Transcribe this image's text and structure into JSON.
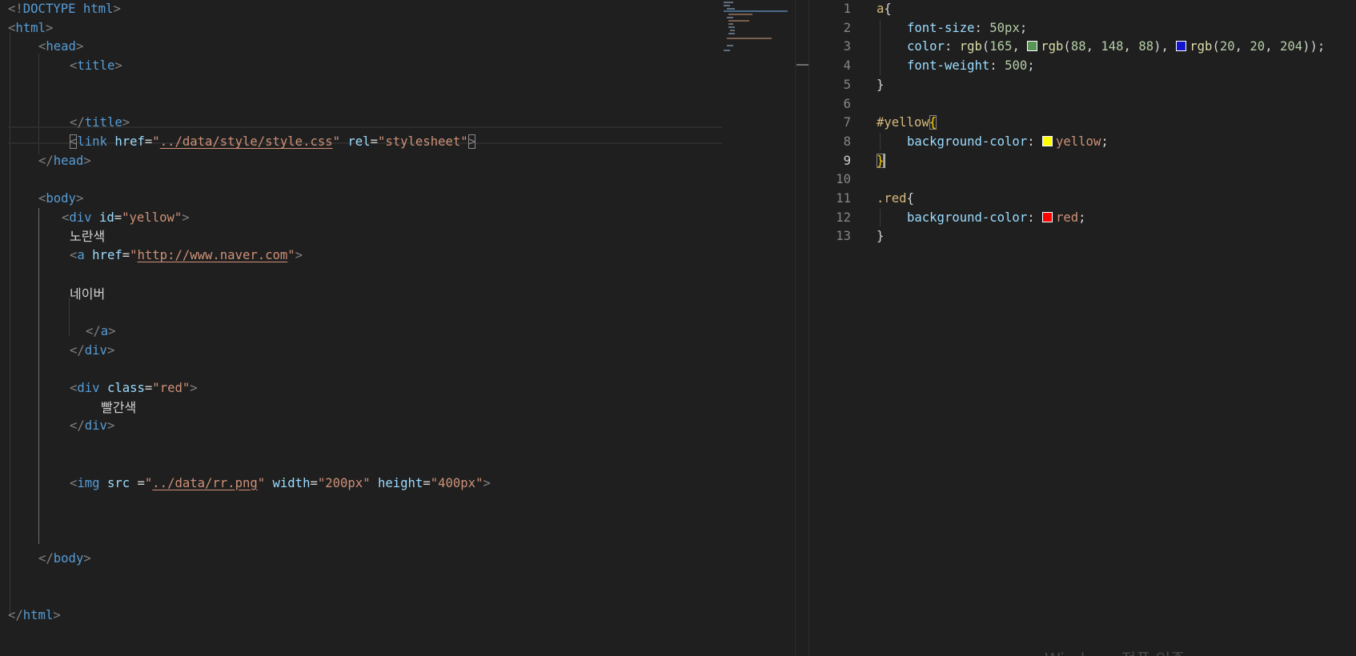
{
  "left_editor": {
    "lines": {
      "doctype": "DOCTYPE html",
      "html_open": "html",
      "head_open": "head",
      "title_open": "title",
      "title_close": "title",
      "link_tag": "link",
      "link_href_attr": "href",
      "link_href_val": "../data/style/style.css",
      "link_rel_attr": "rel",
      "link_rel_val": "stylesheet",
      "head_close": "head",
      "body_open": "body",
      "div_tag": "div",
      "div_id_attr": "id",
      "div_id_val": "yellow",
      "text_yellow": "노란색",
      "a_tag": "a",
      "a_href_attr": "href",
      "a_href_val": "http://www.naver.com",
      "text_naver": "네이버",
      "a_close": "a",
      "div_close": "div",
      "div2_tag": "div",
      "div2_class_attr": "class",
      "div2_class_val": "red",
      "text_red": "빨간색",
      "div2_close": "div",
      "img_tag": "img",
      "img_src_attr": "src",
      "img_src_val": "../data/rr.png",
      "img_width_attr": "width",
      "img_width_val": "200px",
      "img_height_attr": "height",
      "img_height_val": "400px",
      "body_close": "body",
      "html_close": "html"
    }
  },
  "right_editor": {
    "line_numbers": [
      "1",
      "2",
      "3",
      "4",
      "5",
      "6",
      "7",
      "8",
      "9",
      "10",
      "11",
      "12",
      "13"
    ],
    "active_line": "9",
    "css": {
      "sel_a": "a",
      "l2_prop": "font-size",
      "l2_val": "50px",
      "l3_prop": "color",
      "l3_fn1": "rgb",
      "l3_n1": "165",
      "l3_fn2": "rgb",
      "l3_n2a": "88",
      "l3_n2b": "148",
      "l3_n2c": "88",
      "l3_fn3": "rgb",
      "l3_n3a": "20",
      "l3_n3b": "20",
      "l3_n3c": "204",
      "l4_prop": "font-weight",
      "l4_val": "500",
      "sel_yellow": "#yellow",
      "l8_prop": "background-color",
      "l8_val": "yellow",
      "sel_red": ".red",
      "l12_prop": "background-color",
      "l12_val": "red"
    },
    "swatch_colors": {
      "green": "#589458",
      "blue": "#1414cc",
      "yellow": "#ffff00",
      "red": "#ff0000"
    }
  },
  "watermark": "Windows 정품 인증"
}
